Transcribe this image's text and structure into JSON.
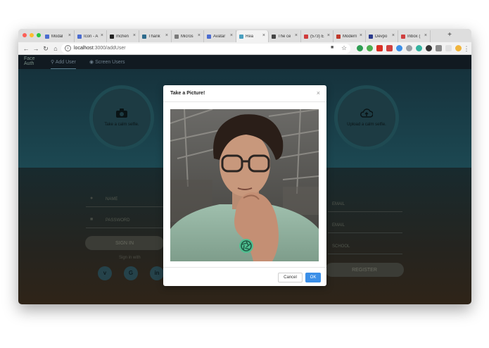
{
  "browser": {
    "tabs": [
      {
        "label": "Modal",
        "color": "#4b6cd0"
      },
      {
        "label": "Icon - A",
        "color": "#4b6cd0"
      },
      {
        "label": "mchen",
        "color": "#222222"
      },
      {
        "label": "Thank",
        "color": "#2d6b8c"
      },
      {
        "label": "Micros",
        "color": "#7a7a7a"
      },
      {
        "label": "Avatar",
        "color": "#4b6cd0"
      },
      {
        "label": "Rea",
        "color": "#4aa0c0"
      },
      {
        "label": "The ce",
        "color": "#444444"
      },
      {
        "label": "(573) E",
        "color": "#d03b3b"
      },
      {
        "label": "Modern",
        "color": "#c0392b"
      },
      {
        "label": "Devpo",
        "color": "#2a3a8c"
      },
      {
        "label": "Inbox (",
        "color": "#d04040"
      }
    ],
    "new_tab": "+",
    "url_host": "localhost",
    "url_path": ":3000/addUser"
  },
  "app": {
    "logo_line1": "Face",
    "logo_line2": "Auth",
    "nav_add_user": "Add User",
    "nav_screen_users": "Screen Users",
    "take_selfie": "Take a calm selfie.",
    "upload_selfie": "Upload a calm selfie.",
    "name_placeholder": "NAME",
    "password_placeholder": "PASSWORD",
    "email_placeholder": "EMAIL",
    "school_placeholder": "SCHOOL",
    "sign_in": "SIGN IN",
    "sign_in_with": "Sign in with",
    "register": "REGISTER"
  },
  "modal": {
    "title": "Take a Picture!",
    "close": "×",
    "cancel": "Cancel",
    "ok": "OK"
  },
  "colors": {
    "ok_button": "#3b8fe8",
    "shutter": "#4fbf90"
  }
}
